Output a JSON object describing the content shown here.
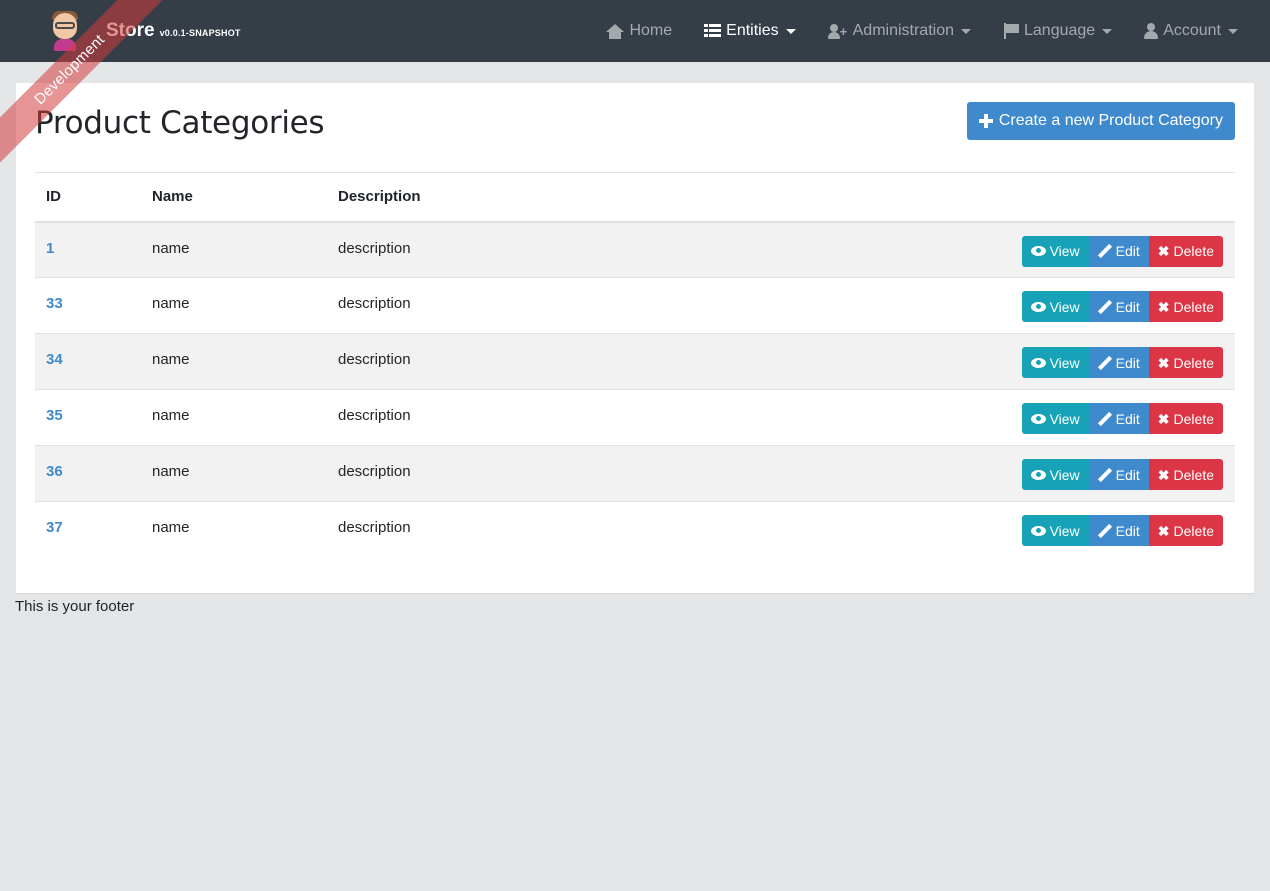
{
  "navbar": {
    "brand_name": "Store",
    "brand_version": "v0.0.1-SNAPSHOT",
    "ribbon": "Development",
    "items": [
      {
        "label": "Home",
        "icon": "home-icon",
        "active": false
      },
      {
        "label": "Entities",
        "icon": "table-icon",
        "active": true
      },
      {
        "label": "Administration",
        "icon": "user-plus-icon",
        "active": false
      },
      {
        "label": "Language",
        "icon": "flag-icon",
        "active": false
      },
      {
        "label": "Account",
        "icon": "user-icon",
        "active": false
      }
    ]
  },
  "page": {
    "title": "Product Categories",
    "create_button": "Create a new Product Category"
  },
  "table": {
    "headers": [
      "ID",
      "Name",
      "Description"
    ],
    "actions": {
      "view": "View",
      "edit": "Edit",
      "delete": "Delete"
    },
    "rows": [
      {
        "id": "1",
        "name": "name",
        "description": "description"
      },
      {
        "id": "33",
        "name": "name",
        "description": "description"
      },
      {
        "id": "34",
        "name": "name",
        "description": "description"
      },
      {
        "id": "35",
        "name": "name",
        "description": "description"
      },
      {
        "id": "36",
        "name": "name",
        "description": "description"
      },
      {
        "id": "37",
        "name": "name",
        "description": "description"
      }
    ]
  },
  "footer": {
    "text": "This is your footer"
  },
  "colors": {
    "navbar": "#353d47",
    "primary": "#3e8acc",
    "info": "#17a2b8",
    "danger": "#dc3545",
    "background": "#e4e5e6"
  }
}
